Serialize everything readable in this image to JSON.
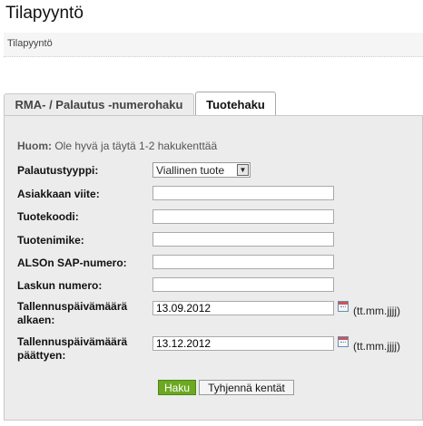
{
  "page_title": "Tilapyyntö",
  "breadcrumb": "Tilapyyntö",
  "tabs": {
    "rma": "RMA- / Palautus -numerohaku",
    "product": "Tuotehaku"
  },
  "note": {
    "label": "Huom:",
    "text": "Ole hyvä ja täytä 1-2 hakukenttää"
  },
  "form": {
    "return_type_label": "Palautustyyppi:",
    "return_type_value": "Viallinen tuote",
    "customer_ref_label": "Asiakkaan viite:",
    "customer_ref_value": "",
    "product_code_label": "Tuotekoodi:",
    "product_code_value": "",
    "product_name_label": "Tuotenimike:",
    "product_name_value": "",
    "sap_label": "ALSOn SAP-numero:",
    "sap_value": "",
    "invoice_label": "Laskun numero:",
    "invoice_value": "",
    "date_from_label_1": "Tallennuspäivämäärä",
    "date_from_label_2": "alkaen:",
    "date_from_value": "13.09.2012",
    "date_to_label_1": "Tallennuspäivämäärä",
    "date_to_label_2": "päättyen:",
    "date_to_value": "13.12.2012",
    "date_format": "(tt.mm.jjjj)"
  },
  "buttons": {
    "search": "Haku",
    "clear": "Tyhjennä kentät"
  }
}
